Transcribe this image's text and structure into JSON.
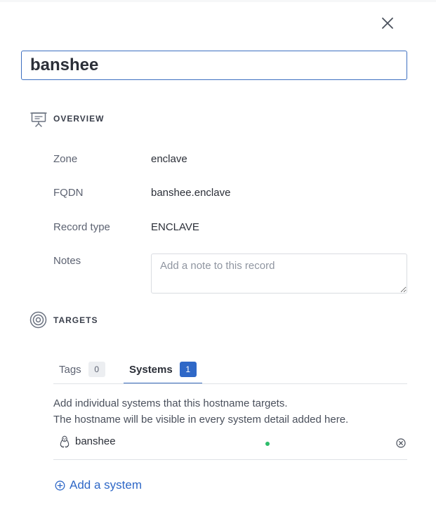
{
  "record_name": "banshee",
  "overview": {
    "title": "OVERVIEW",
    "fields": [
      {
        "label": "Zone",
        "value": "enclave"
      },
      {
        "label": "FQDN",
        "value": "banshee.enclave"
      },
      {
        "label": "Record type",
        "value": "ENCLAVE"
      }
    ],
    "notes_label": "Notes",
    "notes_placeholder": "Add a note to this record",
    "notes_value": ""
  },
  "targets": {
    "title": "TARGETS",
    "tabs": [
      {
        "label": "Tags",
        "count": "0",
        "active": false
      },
      {
        "label": "Systems",
        "count": "1",
        "active": true
      }
    ],
    "help_line1": "Add individual systems that this hostname targets.",
    "help_line2": "The hostname will be visible in every system detail added here.",
    "systems": [
      {
        "name": "banshee",
        "os_icon": "linux-icon",
        "status_color": "#2ebd6b"
      }
    ],
    "add_label": "Add a system"
  },
  "colors": {
    "accent": "#2f68c7",
    "focus_border": "#3d6fc0",
    "status_online": "#2ebd6b"
  }
}
